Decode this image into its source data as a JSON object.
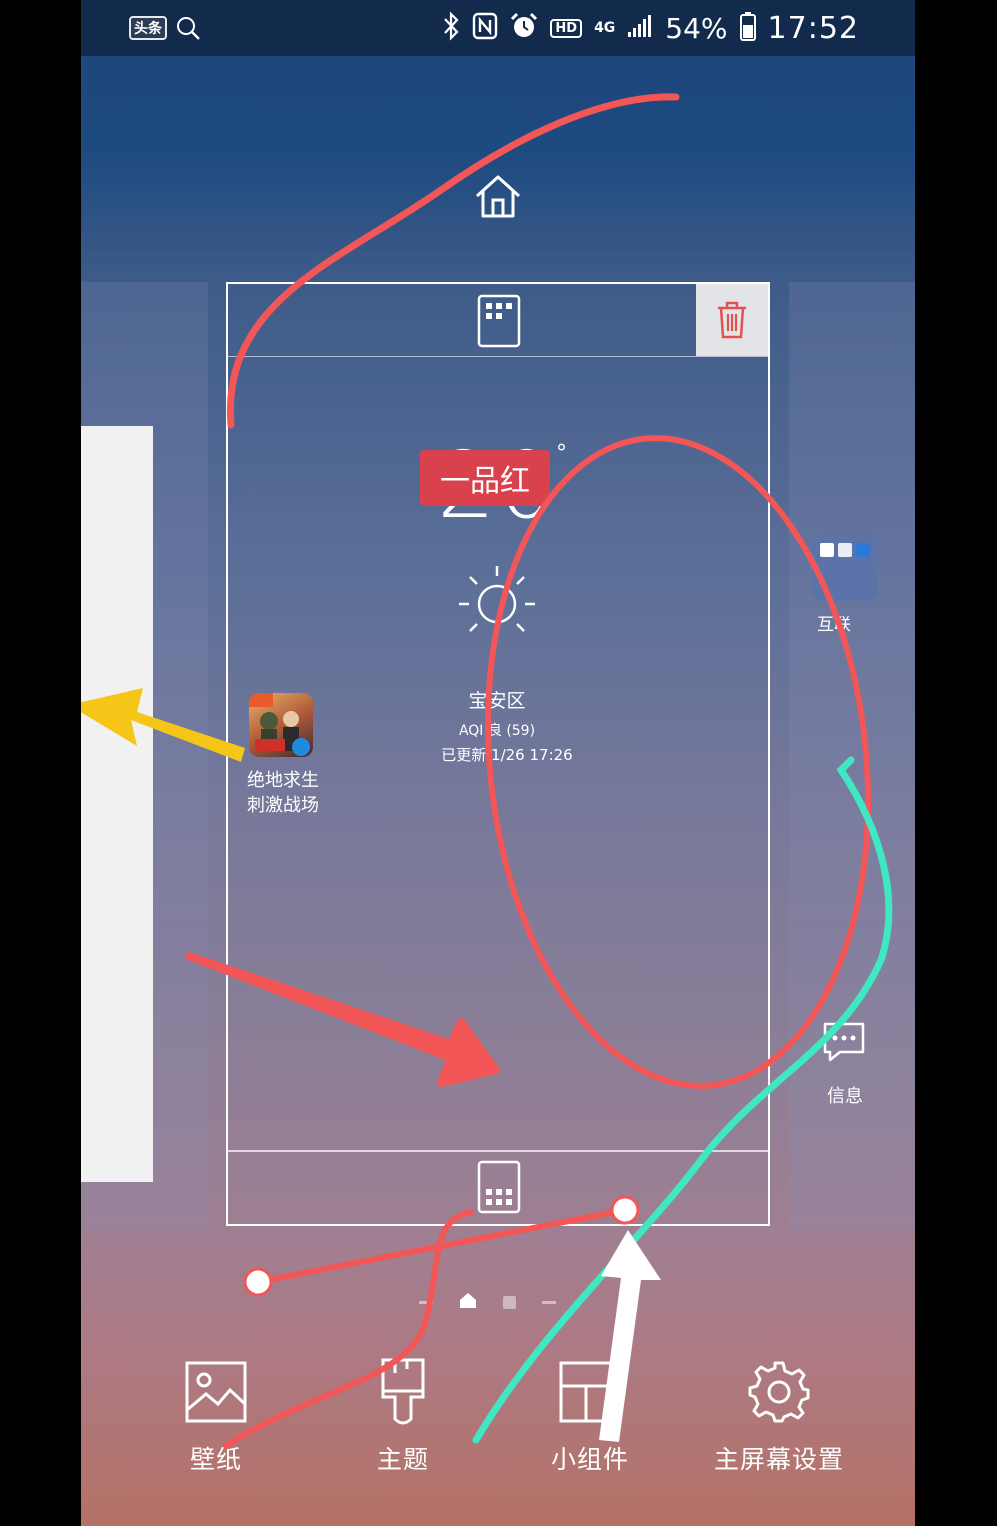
{
  "status_bar": {
    "app_badge": "头条",
    "network": "4G",
    "battery_percent": "54%",
    "time": "17:52",
    "hd_label": "HD",
    "icons": [
      "toutiao-icon",
      "search-icon",
      "bluetooth-icon",
      "nfc-icon",
      "alarm-icon",
      "hd-icon",
      "signal-icon",
      "battery-icon"
    ]
  },
  "home_preview": {
    "top_icon": "home-icon",
    "delete_icon": "trash-icon",
    "page_grid_icon": "grid-icon"
  },
  "weather_widget": {
    "temperature": "20",
    "degree_symbol": "°",
    "ad_badge": "一品红",
    "location": "宝安区",
    "aqi": "AQI 良 (59)",
    "updated": "已更新 1/26 17:26",
    "icon": "sun-icon"
  },
  "apps": [
    {
      "label_line1": "绝地求生",
      "label_line2": "刺激战场",
      "icon": "pubg-icon"
    }
  ],
  "right_page": {
    "folder_label": "互联",
    "messages_label": "信息"
  },
  "bottom_bar": {
    "wallpaper": "壁纸",
    "theme": "主题",
    "widgets": "小组件",
    "home_settings": "主屏幕设置"
  },
  "colors": {
    "annotation_red": "#f25656",
    "annotation_yellow": "#f5c518",
    "annotation_teal": "#3fe8c3",
    "annotation_white": "#ffffff",
    "ad_badge": "#d9424c",
    "statusbar": "#122a4c"
  }
}
